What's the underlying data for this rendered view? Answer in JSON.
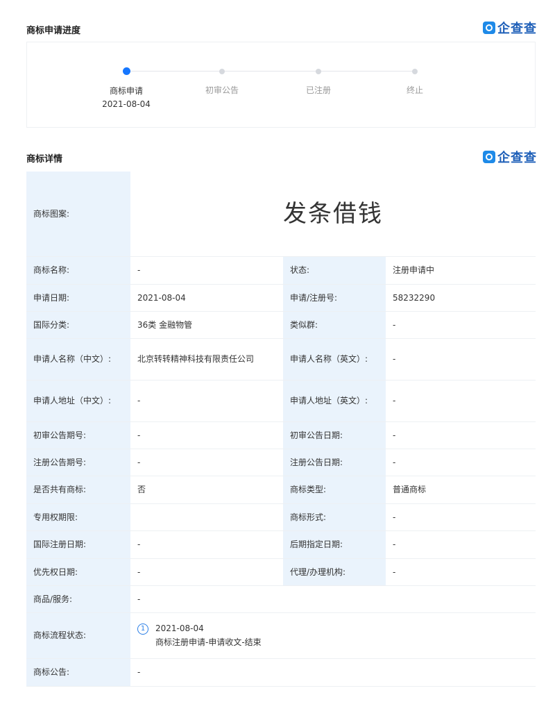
{
  "progress_section": {
    "title": "商标申请进度",
    "brand": "企查查",
    "steps": [
      {
        "label": "商标申请",
        "date": "2021-08-04",
        "active": true
      },
      {
        "label": "初审公告",
        "date": "",
        "active": false
      },
      {
        "label": "已注册",
        "date": "",
        "active": false
      },
      {
        "label": "终止",
        "date": "",
        "active": false
      }
    ]
  },
  "detail_section": {
    "title": "商标详情",
    "brand": "企查查",
    "trademark_image": {
      "label": "商标图案:",
      "text": "发条借钱"
    },
    "rows": [
      {
        "k1": "商标名称:",
        "v1": "-",
        "k2": "状态:",
        "v2": "注册申请中"
      },
      {
        "k1": "申请日期:",
        "v1": "2021-08-04",
        "k2": "申请/注册号:",
        "v2": "58232290"
      },
      {
        "k1": "国际分类:",
        "v1": "36类 金融物管",
        "k2": "类似群:",
        "v2": "-"
      },
      {
        "k1": "申请人名称（中文）:",
        "v1": "北京转转精神科技有限责任公司",
        "k2": "申请人名称（英文）:",
        "v2": "-"
      },
      {
        "k1": "申请人地址（中文）:",
        "v1": "-",
        "k2": "申请人地址（英文）:",
        "v2": "-"
      },
      {
        "k1": "初审公告期号:",
        "v1": "-",
        "k2": "初审公告日期:",
        "v2": "-"
      },
      {
        "k1": "注册公告期号:",
        "v1": "-",
        "k2": "注册公告日期:",
        "v2": "-"
      },
      {
        "k1": "是否共有商标:",
        "v1": "否",
        "k2": "商标类型:",
        "v2": "普通商标"
      },
      {
        "k1": "专用权期限:",
        "v1": "",
        "k2": "商标形式:",
        "v2": "-"
      },
      {
        "k1": "国际注册日期:",
        "v1": "-",
        "k2": "后期指定日期:",
        "v2": "-"
      },
      {
        "k1": "优先权日期:",
        "v1": "-",
        "k2": "代理/办理机构:",
        "v2": "-"
      }
    ],
    "goods_services": {
      "label": "商品/服务:",
      "value": "-"
    },
    "flow_status": {
      "label": "商标流程状态:",
      "index": "1",
      "date": "2021-08-04",
      "desc": "商标注册申请-申请收文-结束"
    },
    "announcement": {
      "label": "商标公告:",
      "value": "-"
    }
  }
}
